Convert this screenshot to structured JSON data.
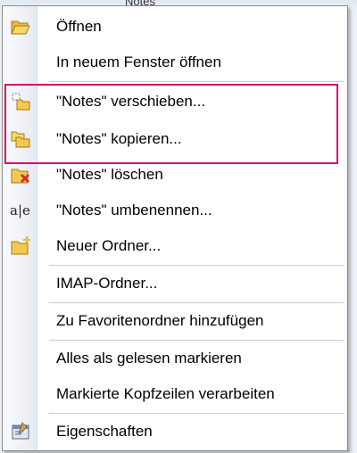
{
  "background_peek": "Notes",
  "menu": {
    "items": [
      {
        "label": "Öffnen",
        "icon": "open-folder-icon"
      },
      {
        "label": "In neuem Fenster öffnen",
        "icon": null
      },
      {
        "label": "\"Notes\" verschieben...",
        "icon": "move-folder-icon"
      },
      {
        "label": "\"Notes\" kopieren...",
        "icon": "copy-folder-icon"
      },
      {
        "label": "\"Notes\" löschen",
        "icon": "delete-folder-icon"
      },
      {
        "label": "\"Notes\" umbenennen...",
        "icon": "rename-icon"
      },
      {
        "label": "Neuer Ordner...",
        "icon": "new-folder-icon"
      },
      {
        "label": "IMAP-Ordner...",
        "icon": null
      },
      {
        "label": "Zu Favoritenordner hinzufügen",
        "icon": null
      },
      {
        "label": "Alles als gelesen markieren",
        "icon": null
      },
      {
        "label": "Markierte Kopfzeilen verarbeiten",
        "icon": null
      },
      {
        "label": "Eigenschaften",
        "icon": "properties-icon"
      }
    ],
    "rename_icon_glyph": "a|e"
  },
  "colors": {
    "highlight_border": "#d0146d",
    "folder_yellow": "#f2c94c",
    "delete_red": "#d32f2f"
  }
}
